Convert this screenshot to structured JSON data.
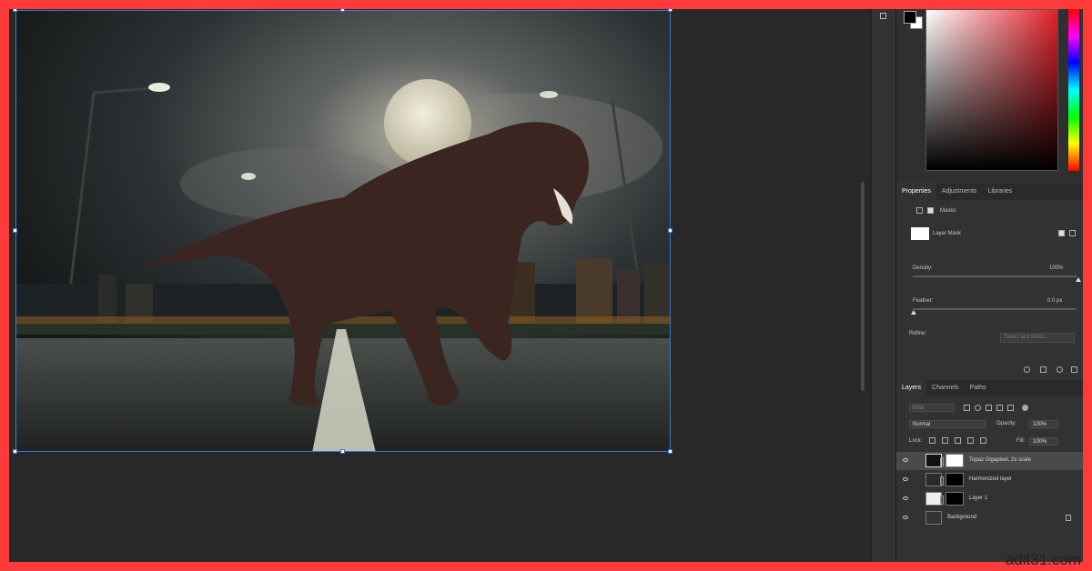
{
  "properties_panel": {
    "tabs": [
      "Properties",
      "Adjustments",
      "Libraries"
    ],
    "masks_label": "Masks",
    "layer_mask_label": "Layer Mask",
    "density_label": "Density:",
    "density_value": "100%",
    "feather_label": "Feather:",
    "feather_value": "0.0 px",
    "refine_label": "Refine:",
    "select_and_mask_label": "Select and Mask..."
  },
  "layers_panel": {
    "tabs": [
      "Layers",
      "Channels",
      "Paths"
    ],
    "search_placeholder": "Kind",
    "blend_mode": "Normal",
    "opacity_label": "Opacity:",
    "opacity_value": "100%",
    "lock_label": "Lock:",
    "fill_label": "Fill:",
    "fill_value": "100%",
    "layers": [
      {
        "name": "Topaz Gigapixel, 2x scale",
        "selected": true
      },
      {
        "name": "Harmonized layer",
        "selected": false
      },
      {
        "name": "Layer 1",
        "selected": false
      },
      {
        "name": "Background",
        "selected": false
      }
    ]
  },
  "colors": {
    "accent": "#3b78c4",
    "frame_border": "#ff3a3a"
  },
  "watermark": "adit31.com"
}
